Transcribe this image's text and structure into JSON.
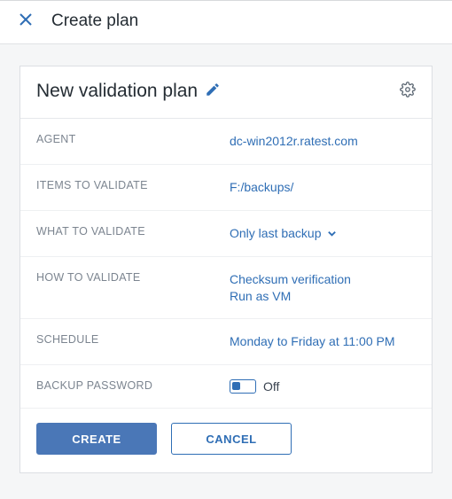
{
  "header": {
    "title": "Create plan"
  },
  "plan": {
    "name": "New validation plan"
  },
  "rows": {
    "agent": {
      "label": "AGENT",
      "value": "dc-win2012r.ratest.com"
    },
    "items": {
      "label": "ITEMS TO VALIDATE",
      "value": "F:/backups/"
    },
    "what": {
      "label": "WHAT TO VALIDATE",
      "value": "Only last backup"
    },
    "how": {
      "label": "HOW TO VALIDATE",
      "line1": "Checksum verification",
      "line2": "Run as VM"
    },
    "schedule": {
      "label": "SCHEDULE",
      "value": "Monday to Friday at 11:00 PM"
    },
    "password": {
      "label": "BACKUP PASSWORD",
      "state": "Off"
    }
  },
  "actions": {
    "create": "CREATE",
    "cancel": "CANCEL"
  }
}
